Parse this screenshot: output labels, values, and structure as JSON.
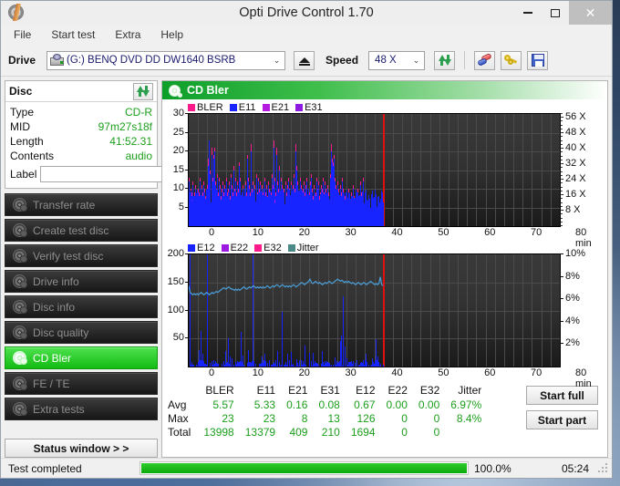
{
  "window": {
    "title": "Opti Drive Control 1.70",
    "app_icon": "disc-icon",
    "minimize": "–",
    "maximize": "▢",
    "close": "✕"
  },
  "menu": [
    {
      "label": "File"
    },
    {
      "label": "Start test"
    },
    {
      "label": "Extra"
    },
    {
      "label": "Help"
    }
  ],
  "toolbar": {
    "drive_label": "Drive",
    "drive_value": "(G:)   BENQ DVD DD DW1640 BSRB",
    "drive_caret": "⌄",
    "eject_icon": "eject-icon",
    "speed_label": "Speed",
    "speed_value": "48 X",
    "speed_caret": "⌄",
    "refresh_icon": "refresh-icon",
    "pills_icon": "pills-icon",
    "key_icon": "key-icon",
    "save_icon": "save-icon"
  },
  "sidebar": {
    "disc_panel": {
      "title": "Disc",
      "refresh_icon": "refresh-icon",
      "rows": [
        {
          "key": "Type",
          "value": "CD-R"
        },
        {
          "key": "MID",
          "value": "97m27s18f"
        },
        {
          "key": "Length",
          "value": "41:52.31"
        },
        {
          "key": "Contents",
          "value": "audio"
        }
      ],
      "label_key": "Label",
      "label_value": "",
      "label_placeholder": "",
      "cd_icon": "cd-disc-icon"
    },
    "nav": [
      {
        "label": "Transfer rate",
        "active": false
      },
      {
        "label": "Create test disc",
        "active": false
      },
      {
        "label": "Verify test disc",
        "active": false
      },
      {
        "label": "Drive info",
        "active": false
      },
      {
        "label": "Disc info",
        "active": false
      },
      {
        "label": "Disc quality",
        "active": false
      },
      {
        "label": "CD Bler",
        "active": true
      },
      {
        "label": "FE / TE",
        "active": false
      },
      {
        "label": "Extra tests",
        "active": false
      }
    ],
    "status_window_button": "Status window > >"
  },
  "main": {
    "header_title": "CD Bler",
    "header_icon": "disc-scan-icon",
    "start_full": "Start full",
    "start_part": "Start part"
  },
  "stats": {
    "columns": [
      "BLER",
      "E11",
      "E21",
      "E31",
      "E12",
      "E22",
      "E32",
      "Jitter"
    ],
    "rows": [
      {
        "name": "Avg",
        "values": [
          "5.57",
          "5.33",
          "0.16",
          "0.08",
          "0.67",
          "0.00",
          "0.00",
          "6.97%"
        ]
      },
      {
        "name": "Max",
        "values": [
          "23",
          "23",
          "8",
          "13",
          "126",
          "0",
          "0",
          "8.4%"
        ]
      },
      {
        "name": "Total",
        "values": [
          "13998",
          "13379",
          "409",
          "210",
          "1694",
          "0",
          "0",
          ""
        ]
      }
    ]
  },
  "statusbar": {
    "text": "Test completed",
    "progress_percent": "100.0%",
    "progress_value": 100,
    "elapsed": "05:24"
  },
  "colors": {
    "bler": "#ff1a8c",
    "e11": "#1824ff",
    "e21": "#b41ae0",
    "e31": "#8c1ae0",
    "e12": "#1824ff",
    "e22": "#9c1ae0",
    "e32": "#ff1a8c",
    "jitter": "#4a9ed8",
    "end_marker": "#e01010",
    "accent_green": "#13bb13",
    "value_green": "#1c9e1c"
  },
  "chart_data": [
    {
      "type": "bar",
      "title": "CD Bler - error rates",
      "xlabel": "min",
      "ylabel": "",
      "xlim": [
        0,
        80
      ],
      "ylim": [
        0,
        30
      ],
      "xticks": [
        0,
        10,
        20,
        30,
        40,
        50,
        60,
        70,
        80
      ],
      "xtick_labels": [
        "0",
        "10",
        "20",
        "30",
        "40",
        "50",
        "60",
        "70",
        "80 min"
      ],
      "yticks": [
        5,
        10,
        15,
        20,
        25,
        30
      ],
      "ytick_labels": [
        "5",
        "10",
        "15",
        "20",
        "25",
        "30"
      ],
      "right_axis_label": "X",
      "right_ticks": [
        8,
        16,
        24,
        32,
        40,
        48,
        56
      ],
      "right_tick_labels": [
        "8 X",
        "16 X",
        "24 X",
        "32 X",
        "40 X",
        "48 X",
        "56 X"
      ],
      "right_lim": [
        0,
        58
      ],
      "grid": true,
      "legend": [
        {
          "name": "BLER",
          "color": "#ff1a8c"
        },
        {
          "name": "E11",
          "color": "#1824ff"
        },
        {
          "name": "E21",
          "color": "#b41ae0"
        },
        {
          "name": "E31",
          "color": "#8c1ae0"
        }
      ],
      "data_end_min": 41.9,
      "series": [
        {
          "name": "BLER",
          "color": "#ff1a8c",
          "note": "avg 5.57, max 23, total 13998"
        },
        {
          "name": "E11",
          "color": "#1824ff",
          "note": "avg 5.33, max 23, total 13379"
        },
        {
          "name": "E21",
          "color": "#b41ae0",
          "note": "avg 0.16, max 8, total 409"
        },
        {
          "name": "E31",
          "color": "#8c1ae0",
          "note": "avg 0.08, max 13, total 210"
        }
      ],
      "bler_samples": [
        13,
        8,
        10,
        9,
        12,
        7,
        9,
        11,
        8,
        10,
        9,
        13,
        8,
        11,
        9,
        12,
        10,
        8,
        9,
        11,
        18,
        22,
        15,
        21,
        13,
        19,
        21,
        12,
        10,
        14,
        9,
        13,
        11,
        8,
        10,
        12,
        9,
        11,
        13,
        9,
        10,
        12,
        8,
        14,
        11,
        9,
        16,
        10,
        13,
        9,
        12,
        10,
        17,
        13,
        9,
        11,
        8,
        10,
        12,
        9,
        19,
        13,
        11,
        9,
        22,
        10,
        12,
        8,
        11,
        14,
        9,
        13,
        10,
        12,
        8,
        11,
        9,
        10,
        13,
        9,
        11,
        8,
        12,
        10,
        9,
        14,
        11,
        23,
        13,
        9,
        21,
        12,
        10,
        16,
        9,
        13,
        11,
        8,
        10,
        12,
        9,
        11,
        13,
        10,
        8,
        12,
        9,
        11,
        14,
        10,
        22,
        16,
        12,
        9,
        13,
        11,
        8,
        10,
        12,
        9,
        11,
        13,
        8,
        10,
        9,
        12,
        14,
        10,
        8,
        11,
        9,
        13,
        10,
        12,
        8,
        9,
        11,
        10,
        13,
        9,
        12,
        10,
        8,
        11,
        9,
        14,
        22,
        18,
        17,
        19,
        13,
        11,
        9,
        12,
        10,
        8,
        11,
        9,
        13,
        10,
        8,
        6,
        9,
        7,
        10,
        8,
        6,
        9,
        7,
        11,
        8,
        6,
        9,
        7,
        10,
        8,
        12,
        9,
        7,
        13,
        5,
        4,
        3,
        4,
        5,
        3,
        4,
        5,
        3,
        4,
        0,
        0,
        0,
        0,
        0,
        0,
        0,
        0,
        0,
        0
      ],
      "e11_samples": [
        12,
        7,
        9,
        8,
        11,
        6,
        8,
        10,
        7,
        9,
        8,
        12,
        7,
        10,
        8,
        11,
        9,
        7,
        8,
        10,
        16,
        23,
        14,
        19,
        12,
        18,
        20,
        11,
        9,
        13,
        8,
        12,
        10,
        7,
        9,
        11,
        8,
        10,
        12,
        8,
        9,
        11,
        7,
        13,
        10,
        8,
        15,
        9,
        12,
        8,
        11,
        9,
        16,
        12,
        8,
        10,
        7,
        9,
        11,
        8,
        18,
        12,
        10,
        8,
        20,
        9,
        11,
        7,
        10,
        13,
        8,
        12,
        9,
        11,
        7,
        10,
        8,
        9,
        12,
        8,
        10,
        7,
        11,
        9,
        8,
        13,
        10,
        21,
        12,
        8,
        19,
        11,
        9,
        15,
        8,
        12,
        10,
        7,
        9,
        11,
        8,
        10,
        12,
        9,
        7,
        11,
        8,
        10,
        13,
        9,
        20,
        15,
        11,
        8,
        12,
        10,
        7,
        9,
        11,
        8,
        10,
        12,
        7,
        9,
        8,
        11,
        13,
        9,
        7,
        10,
        8,
        12,
        9,
        11,
        7,
        8,
        10,
        9,
        12,
        8,
        11,
        9,
        7,
        10,
        8,
        13,
        20,
        17,
        16,
        18,
        12,
        10,
        8,
        11,
        9,
        7,
        10,
        8,
        12,
        9,
        7,
        5,
        8,
        6,
        9,
        7,
        5,
        8,
        6,
        10,
        7,
        5,
        8,
        6,
        9,
        7,
        11,
        8,
        6,
        12,
        4,
        3,
        2,
        3,
        4,
        2,
        3,
        4,
        2,
        3,
        0,
        0,
        0,
        0,
        0,
        0,
        0,
        0,
        0,
        0
      ]
    },
    {
      "type": "line+bar",
      "title": "CD Bler - E12 / E22 / E32 / Jitter",
      "xlabel": "min",
      "ylabel": "",
      "xlim": [
        0,
        80
      ],
      "ylim": [
        0,
        200
      ],
      "xticks": [
        0,
        10,
        20,
        30,
        40,
        50,
        60,
        70,
        80
      ],
      "xtick_labels": [
        "0",
        "10",
        "20",
        "30",
        "40",
        "50",
        "60",
        "70",
        "80 min"
      ],
      "yticks": [
        50,
        100,
        150,
        200
      ],
      "ytick_labels": [
        "50",
        "100",
        "150",
        "200"
      ],
      "right_ticks": [
        2,
        4,
        6,
        8,
        10
      ],
      "right_tick_labels": [
        "2%",
        "4%",
        "6%",
        "8%",
        "10%"
      ],
      "right_lim": [
        0,
        10
      ],
      "grid": true,
      "legend": [
        {
          "name": "E12",
          "color": "#1824ff"
        },
        {
          "name": "E22",
          "color": "#9c1ae0"
        },
        {
          "name": "E32",
          "color": "#ff1a8c"
        },
        {
          "name": "Jitter",
          "color": "#4a8a8a"
        }
      ],
      "data_end_min": 41.9,
      "series": [
        {
          "name": "E12",
          "color": "#1824ff",
          "note": "avg 0.67, max 126, total 1694"
        },
        {
          "name": "E22",
          "color": "#9c1ae0",
          "note": "avg 0.00, max 0, total 0"
        },
        {
          "name": "E32",
          "color": "#ff1a8c",
          "note": "avg 0.00, max 0, total 0"
        },
        {
          "name": "Jitter",
          "color": "#4a9ed8",
          "note": "avg 6.97%, max 8.4%"
        }
      ],
      "jitter_samples": [
        7.2,
        6.6,
        6.5,
        6.4,
        6.5,
        6.4,
        6.5,
        6.4,
        6.5,
        6.6,
        6.5,
        6.4,
        6.5,
        6.6,
        6.5,
        6.4,
        6.5,
        6.6,
        6.5,
        6.6,
        6.7,
        6.6,
        6.7,
        6.8,
        6.9,
        7.0,
        7.0,
        6.9,
        7.0,
        7.1,
        7.0,
        6.9,
        6.9,
        6.8,
        6.9,
        6.8,
        6.9,
        6.8,
        6.9,
        7.0,
        7.1,
        7.0,
        6.9,
        7.0,
        7.1,
        7.0,
        7.1,
        7.2,
        7.1,
        7.0,
        7.1,
        7.0,
        7.1,
        7.0,
        7.1,
        7.0,
        7.1,
        7.2,
        7.1,
        7.0,
        7.1,
        7.2,
        7.1,
        7.2,
        7.3,
        7.2,
        7.1,
        7.2,
        7.3,
        7.2,
        7.1,
        7.2,
        7.1,
        7.2,
        7.1,
        7.2,
        7.3,
        7.2,
        7.1,
        7.2,
        7.3,
        7.4,
        7.5,
        7.4,
        7.3,
        7.4,
        7.5,
        7.6,
        7.8,
        7.5,
        7.4,
        7.5,
        7.6,
        7.5,
        7.4,
        7.5,
        7.4,
        7.3,
        7.4,
        7.5,
        7.4,
        7.5,
        7.6,
        7.5,
        7.4,
        7.5,
        7.6,
        7.7,
        7.8,
        7.7,
        7.6,
        7.7,
        7.6,
        7.5,
        7.6,
        7.5,
        7.6,
        7.5,
        7.4,
        7.5,
        7.4,
        7.3,
        7.4,
        7.5,
        7.4,
        7.3,
        7.4,
        7.5,
        7.4,
        7.3,
        7.4,
        7.5,
        7.6,
        7.5,
        7.4,
        7.3,
        7.4,
        7.3,
        7.4,
        8.0,
        7.3,
        7.2,
        0,
        0,
        0,
        0,
        0,
        0,
        0,
        0,
        0,
        0,
        0,
        0,
        0,
        0,
        0,
        0,
        0,
        0
      ],
      "e12_spikes": [
        {
          "min": 0.2,
          "value": 200
        },
        {
          "min": 2.2,
          "value": 30
        },
        {
          "min": 2.6,
          "value": 63
        },
        {
          "min": 2.9,
          "value": 22
        },
        {
          "min": 3.9,
          "value": 200
        },
        {
          "min": 7.8,
          "value": 27
        },
        {
          "min": 8.4,
          "value": 50
        },
        {
          "min": 8.8,
          "value": 18
        },
        {
          "min": 9.2,
          "value": 14
        },
        {
          "min": 11.2,
          "value": 62
        },
        {
          "min": 11.6,
          "value": 20
        },
        {
          "min": 12.7,
          "value": 30
        },
        {
          "min": 13.7,
          "value": 200
        },
        {
          "min": 15.8,
          "value": 18
        },
        {
          "min": 16.3,
          "value": 22
        },
        {
          "min": 17.2,
          "value": 12
        },
        {
          "min": 19.0,
          "value": 28
        },
        {
          "min": 20.1,
          "value": 98
        },
        {
          "min": 21.3,
          "value": 22
        },
        {
          "min": 22.1,
          "value": 26
        },
        {
          "min": 23.2,
          "value": 13
        },
        {
          "min": 25.0,
          "value": 37
        },
        {
          "min": 26.0,
          "value": 25
        },
        {
          "min": 26.8,
          "value": 24
        },
        {
          "min": 28.6,
          "value": 28
        },
        {
          "min": 31.5,
          "value": 16
        },
        {
          "min": 32.6,
          "value": 45
        },
        {
          "min": 32.9,
          "value": 56
        },
        {
          "min": 33.3,
          "value": 126
        },
        {
          "min": 33.6,
          "value": 36
        },
        {
          "min": 34.0,
          "value": 14
        },
        {
          "min": 36.2,
          "value": 12
        },
        {
          "min": 38.2,
          "value": 22
        },
        {
          "min": 39.6,
          "value": 14
        },
        {
          "min": 40.3,
          "value": 48
        },
        {
          "min": 40.7,
          "value": 18
        }
      ]
    }
  ]
}
